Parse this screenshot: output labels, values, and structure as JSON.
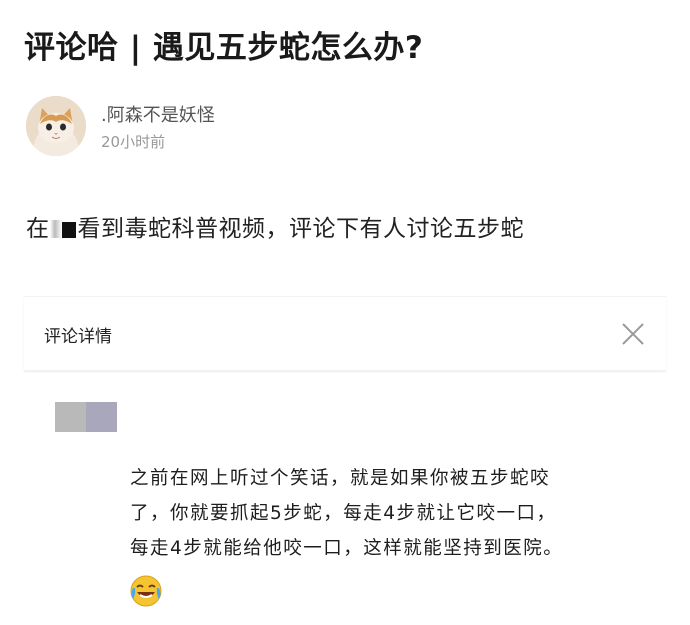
{
  "post": {
    "title": "评论哈 | 遇见五步蛇怎么办?",
    "author": ".阿森不是妖怪",
    "time": "20小时前",
    "body_prefix": "在",
    "body_suffix": "看到毒蛇科普视频，评论下有人讨论五步蛇"
  },
  "comment_panel": {
    "title": "评论详情",
    "close_icon": "close-icon",
    "comment_lines": [
      "之前在网上听过个笑话，就是如果你被五步蛇咬",
      "了，你就要抓起5步蛇，每走4步就让它咬一口，",
      "每走4步就能给他咬一口，这样就能坚持到医院。"
    ],
    "emoji_icon": "laughing-crying-emoji-icon"
  },
  "colors": {
    "text_primary": "#1a1a1a",
    "text_secondary": "#555555",
    "text_muted": "#999999"
  }
}
